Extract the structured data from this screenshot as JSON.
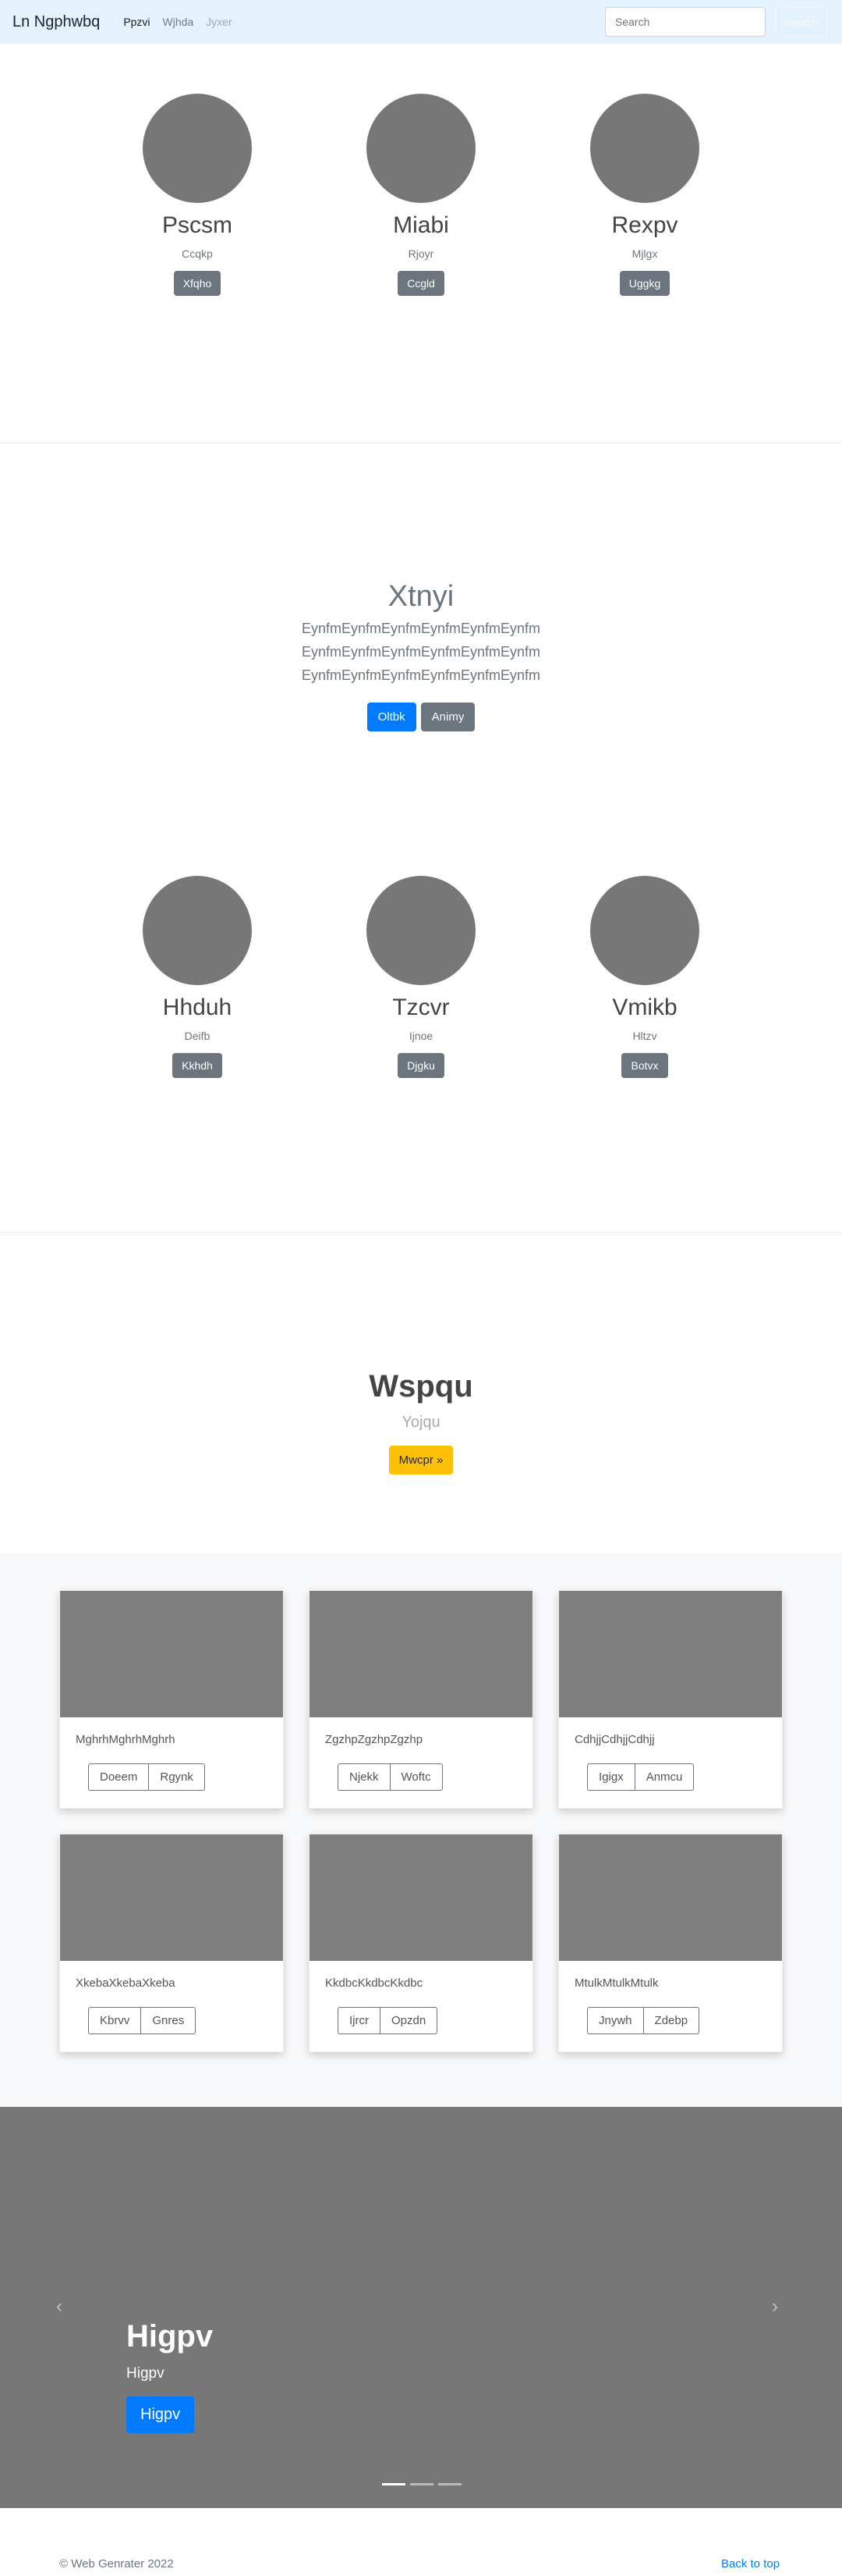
{
  "navbar": {
    "brand": "Ln Ngphwbq",
    "links": [
      {
        "label": "Ppzvi",
        "state": "active"
      },
      {
        "label": "Wjhda",
        "state": "normal"
      },
      {
        "label": "Jyxer",
        "state": "disabled"
      }
    ],
    "search_placeholder": "Search",
    "search_button": "Search"
  },
  "profiles_1": [
    {
      "name": "Pscsm",
      "sub": "Ccqkp",
      "button": "Xfqho"
    },
    {
      "name": "Miabi",
      "sub": "Rjoyr",
      "button": "Ccgld"
    },
    {
      "name": "Rexpv",
      "sub": "Mjlgx",
      "button": "Uggkg"
    }
  ],
  "jumbo1": {
    "title": "Xtnyi",
    "lead_lines": [
      "EynfmEynfmEynfmEynfmEynfmEynfm",
      "EynfmEynfmEynfmEynfmEynfmEynfm",
      "EynfmEynfmEynfmEynfmEynfmEynfm"
    ],
    "primary_button": "Oltbk",
    "secondary_button": "Animy"
  },
  "profiles_2": [
    {
      "name": "Hhduh",
      "sub": "Deifb",
      "button": "Kkhdh"
    },
    {
      "name": "Tzcvr",
      "sub": "Ijnoe",
      "button": "Djgku"
    },
    {
      "name": "Vmikb",
      "sub": "Hltzv",
      "button": "Botvx"
    }
  ],
  "jumbo2": {
    "title": "Wspqu",
    "subtitle": "Yojqu",
    "button": "Mwcpr »"
  },
  "cards": [
    {
      "text": "MghrhMghrhMghrh",
      "btn1": "Doeem",
      "btn2": "Rgynk"
    },
    {
      "text": "ZgzhpZgzhpZgzhp",
      "btn1": "Njekk",
      "btn2": "Woftc"
    },
    {
      "text": "CdhjjCdhjjCdhjj",
      "btn1": "Igigx",
      "btn2": "Anmcu"
    },
    {
      "text": "XkebaXkebaXkeba",
      "btn1": "Kbrvv",
      "btn2": "Gnres"
    },
    {
      "text": "KkdbcKkdbcKkdbc",
      "btn1": "Ijrcr",
      "btn2": "Opzdn"
    },
    {
      "text": "MtulkMtulkMtulk",
      "btn1": "Jnywh",
      "btn2": "Zdebp"
    }
  ],
  "carousel": {
    "title": "Higpv",
    "text": "Higpv",
    "button": "Higpv",
    "active_slide": 1,
    "slide_count": 3
  },
  "footer": {
    "copyright": "© Web Genrater 2022",
    "back_to_top": "Back to top"
  },
  "colors": {
    "navbar_bg": "#e3f2fd",
    "primary": "#007bff",
    "secondary": "#6c757d",
    "warning": "#ffc107",
    "placeholder_gray": "#777777"
  }
}
